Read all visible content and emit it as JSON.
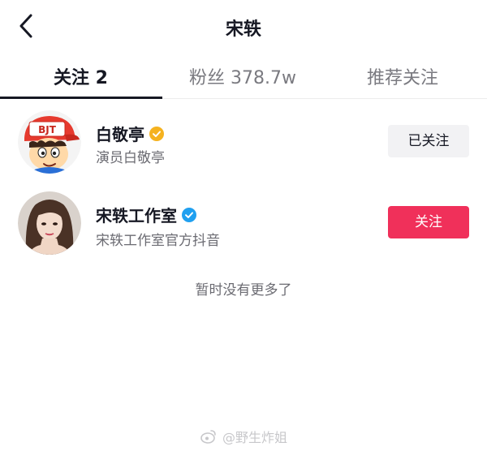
{
  "header": {
    "title": "宋轶"
  },
  "tabs": [
    {
      "label": "关注 2",
      "active": true
    },
    {
      "label": "粉丝 378.7w",
      "active": false
    },
    {
      "label": "推荐关注",
      "active": false
    }
  ],
  "list": [
    {
      "name": "白敬亭",
      "description": "演员白敬亭",
      "verified_color": "#f5b21f",
      "button_label": "已关注",
      "avatar_cap_text": "BJT"
    },
    {
      "name": "宋轶工作室",
      "description": "宋轶工作室官方抖音",
      "verified_color": "#20a0f0",
      "button_label": "关注"
    }
  ],
  "footer": {
    "no_more_text": "暂时没有更多了"
  },
  "watermark": {
    "text": "@野生炸姐"
  },
  "colors": {
    "accent": "#f0305a",
    "text": "#161823",
    "secondary": "#6b6b72"
  }
}
